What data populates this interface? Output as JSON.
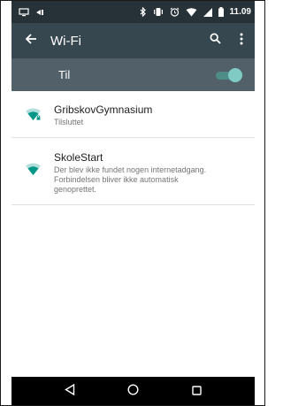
{
  "status_bar": {
    "time": "11.09",
    "left_icons": [
      "screen-icon",
      "cast-icon"
    ],
    "right_icons": [
      "bluetooth-icon",
      "vibrate-icon",
      "alarm-icon",
      "wifi-signal-icon",
      "cell-signal-icon",
      "battery-icon"
    ]
  },
  "app_bar": {
    "title": "Wi-Fi",
    "back_icon": "arrow-back-icon",
    "actions": [
      "search-icon",
      "more-vert-icon"
    ]
  },
  "toggle": {
    "label": "Til",
    "state": "on"
  },
  "networks": [
    {
      "name": "GribskovGymnasium",
      "status": "Tilsluttet",
      "icon": "wifi-locked-icon"
    },
    {
      "name": "SkoleStart",
      "status": "Der blev ikke fundet nogen internetadgang.\nForbindelsen bliver ikke automatisk\ngenoprettet.",
      "icon": "wifi-icon"
    }
  ],
  "nav_bar": {
    "buttons": [
      "back-triangle-icon",
      "home-circle-icon",
      "recents-square-icon"
    ]
  },
  "colors": {
    "status_bar": "#263238",
    "app_bar": "#37474f",
    "toggle_bar": "#526069",
    "accent": "#009688",
    "switch_thumb": "#80cbc4"
  }
}
